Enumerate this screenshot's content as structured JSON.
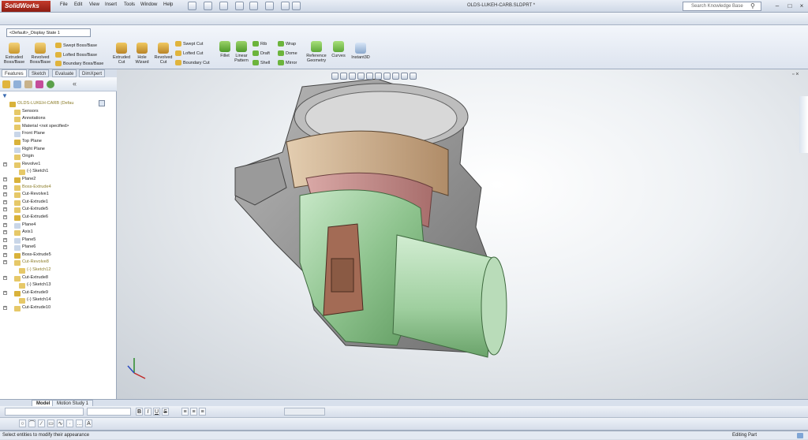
{
  "app": {
    "name": "SolidWorks",
    "document_title": "OLDS-LUKEH-CARB.SLDPRT *"
  },
  "menu": [
    "File",
    "Edit",
    "View",
    "Insert",
    "Tools",
    "Window",
    "Help"
  ],
  "search": {
    "placeholder": "Search Knowledge Base"
  },
  "configuration": {
    "selected": "<Default>_Display State 1"
  },
  "ribbon": {
    "extruded_boss": "Extruded Boss/Base",
    "revolved_boss": "Revolved Boss/Base",
    "swept_boss": "Swept Boss/Base",
    "lofted_boss": "Lofted Boss/Base",
    "boundary_boss": "Boundary Boss/Base",
    "extruded_cut": "Extruded Cut",
    "hole_wizard": "Hole Wizard",
    "revolved_cut": "Revolved Cut",
    "swept_cut": "Swept Cut",
    "lofted_cut": "Lofted Cut",
    "boundary_cut": "Boundary Cut",
    "fillet": "Fillet",
    "linear_pattern": "Linear Pattern",
    "rib": "Rib",
    "draft": "Draft",
    "shell": "Shell",
    "wrap": "Wrap",
    "dome": "Dome",
    "mirror": "Mirror",
    "reference_geometry": "Reference Geometry",
    "curves": "Curves",
    "instant3d": "Instant3D"
  },
  "panel_tabs": [
    "Features",
    "Sketch",
    "Evaluate",
    "DimXpert"
  ],
  "tree": [
    {
      "label": "OLDS-LUKEH-CARB  (Defau",
      "indent": 0,
      "color": "#8c7d2a"
    },
    {
      "label": "Sensors",
      "indent": 1
    },
    {
      "label": "Annotations",
      "indent": 1
    },
    {
      "label": "Material <not specified>",
      "indent": 1
    },
    {
      "label": "Front Plane",
      "indent": 1
    },
    {
      "label": "Top Plane",
      "indent": 1
    },
    {
      "label": "Right Plane",
      "indent": 1
    },
    {
      "label": "Origin",
      "indent": 1
    },
    {
      "label": "Revolve1",
      "indent": 1
    },
    {
      "label": "(-) Sketch1",
      "indent": 2
    },
    {
      "label": "Plane2",
      "indent": 1
    },
    {
      "label": "Boss-Extrude4",
      "indent": 1,
      "color": "#8c7d2a"
    },
    {
      "label": "Cut-Revolve1",
      "indent": 1
    },
    {
      "label": "Cut-Extrude1",
      "indent": 1
    },
    {
      "label": "Cut-Extrude5",
      "indent": 1
    },
    {
      "label": "Cut-Extrude6",
      "indent": 1
    },
    {
      "label": "Plane4",
      "indent": 1
    },
    {
      "label": "Axis1",
      "indent": 1
    },
    {
      "label": "Plane5",
      "indent": 1
    },
    {
      "label": "Plane6",
      "indent": 1
    },
    {
      "label": "Boss-Extrude5",
      "indent": 1
    },
    {
      "label": "Cut-Revolve8",
      "indent": 1,
      "color": "#8c7d2a"
    },
    {
      "label": "(-) Sketch12",
      "indent": 2,
      "color": "#8c7d2a"
    },
    {
      "label": "Cut-Extrude8",
      "indent": 1
    },
    {
      "label": "(-) Sketch13",
      "indent": 2
    },
    {
      "label": "Cut-Extrude9",
      "indent": 1
    },
    {
      "label": "(-) Sketch14",
      "indent": 2
    },
    {
      "label": "Cut-Extrude10",
      "indent": 1
    }
  ],
  "bottom_tabs": [
    "Model",
    "Motion Study 1"
  ],
  "status": {
    "left": "Select entities to modify their appearance",
    "right": "Editing Part"
  },
  "colors": {
    "part_body": "#8a8a8a",
    "green": "#8fc48f",
    "tan": "#c6a888",
    "pink": "#c98e8c"
  }
}
